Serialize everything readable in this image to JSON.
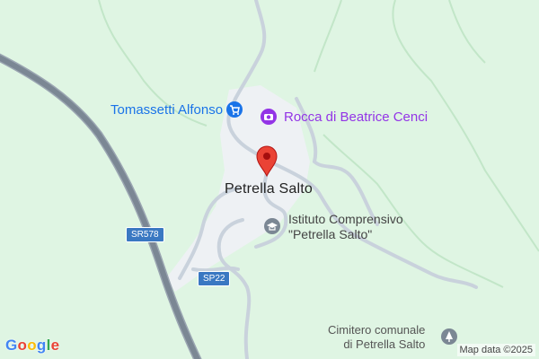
{
  "map": {
    "town_label": "Petrella Salto",
    "pois": {
      "shop": "Tomassetti Alfonso",
      "attraction": "Rocca di Beatrice Cenci",
      "school": "Istituto Comprensivo\n\"Petrella Salto\"",
      "cemetery": "Cimitero comunale\ndi Petrella Salto"
    },
    "road_shields": {
      "sr578": "SR578",
      "sp22": "SP22"
    },
    "attribution": "Map data ©2025",
    "logo_letters": [
      "G",
      "o",
      "o",
      "g",
      "l",
      "e"
    ],
    "colors": {
      "land": "#dff5e3",
      "town_area": "#eef1f4",
      "road": "#c9d2dc",
      "highway": "#7b8794",
      "pin": "#ea4335",
      "shop": "#1a73e8",
      "attraction": "#9334e6",
      "logo": [
        "#4285f4",
        "#ea4335",
        "#fbbc05",
        "#4285f4",
        "#34a853",
        "#ea4335"
      ]
    },
    "icons": [
      "shopping-cart-icon",
      "camera-icon",
      "graduation-cap-icon",
      "cemetery-icon",
      "map-pin-icon"
    ]
  }
}
